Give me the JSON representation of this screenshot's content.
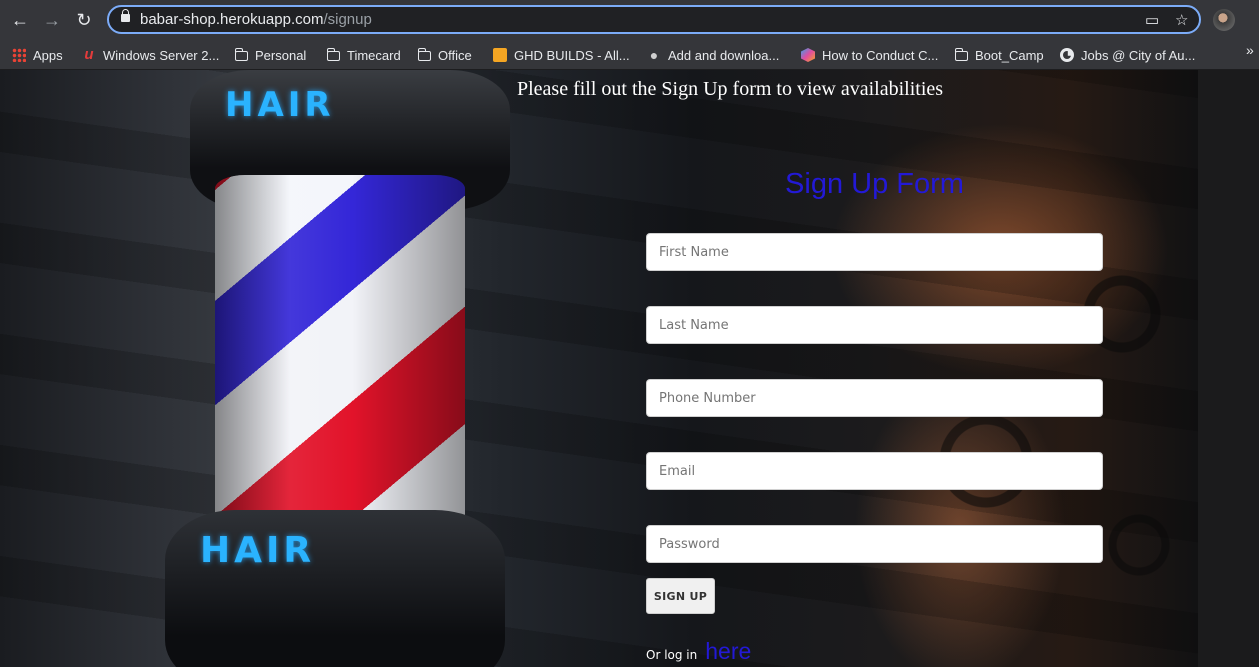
{
  "browser": {
    "url_domain": "babar-shop.herokuapp.com",
    "url_path": "/signup",
    "nav_back_icon": "←",
    "nav_forward_icon": "→",
    "reload_icon": "↻"
  },
  "bookmarks": [
    {
      "label": "Apps",
      "icon": "apps-icon"
    },
    {
      "label": "Windows Server 2...",
      "icon": "u-icon"
    },
    {
      "label": "Personal",
      "icon": "folder-icon"
    },
    {
      "label": "Timecard",
      "icon": "folder-icon"
    },
    {
      "label": "Office",
      "icon": "folder-icon"
    },
    {
      "label": "GHD BUILDS - All...",
      "icon": "ghd-icon"
    },
    {
      "label": "Add and downloa...",
      "icon": "apple-icon"
    },
    {
      "label": "How to Conduct C...",
      "icon": "hexagon-icon"
    },
    {
      "label": "Boot_Camp",
      "icon": "folder-icon"
    },
    {
      "label": "Jobs @ City of Au...",
      "icon": "globe-icon"
    }
  ],
  "page": {
    "headline": "Please fill out the Sign Up form to view availabilities",
    "logo_text": "HAIR",
    "form": {
      "title": "Sign Up Form",
      "first_name_placeholder": "First Name",
      "last_name_placeholder": "Last Name",
      "phone_placeholder": "Phone Number",
      "email_placeholder": "Email",
      "password_placeholder": "Password",
      "submit_label": "SIGN UP",
      "login_prompt": "Or log in",
      "login_link": "here"
    }
  },
  "colors": {
    "accent_blue": "#2319d6",
    "omnibox_focus": "#7cacf8"
  }
}
